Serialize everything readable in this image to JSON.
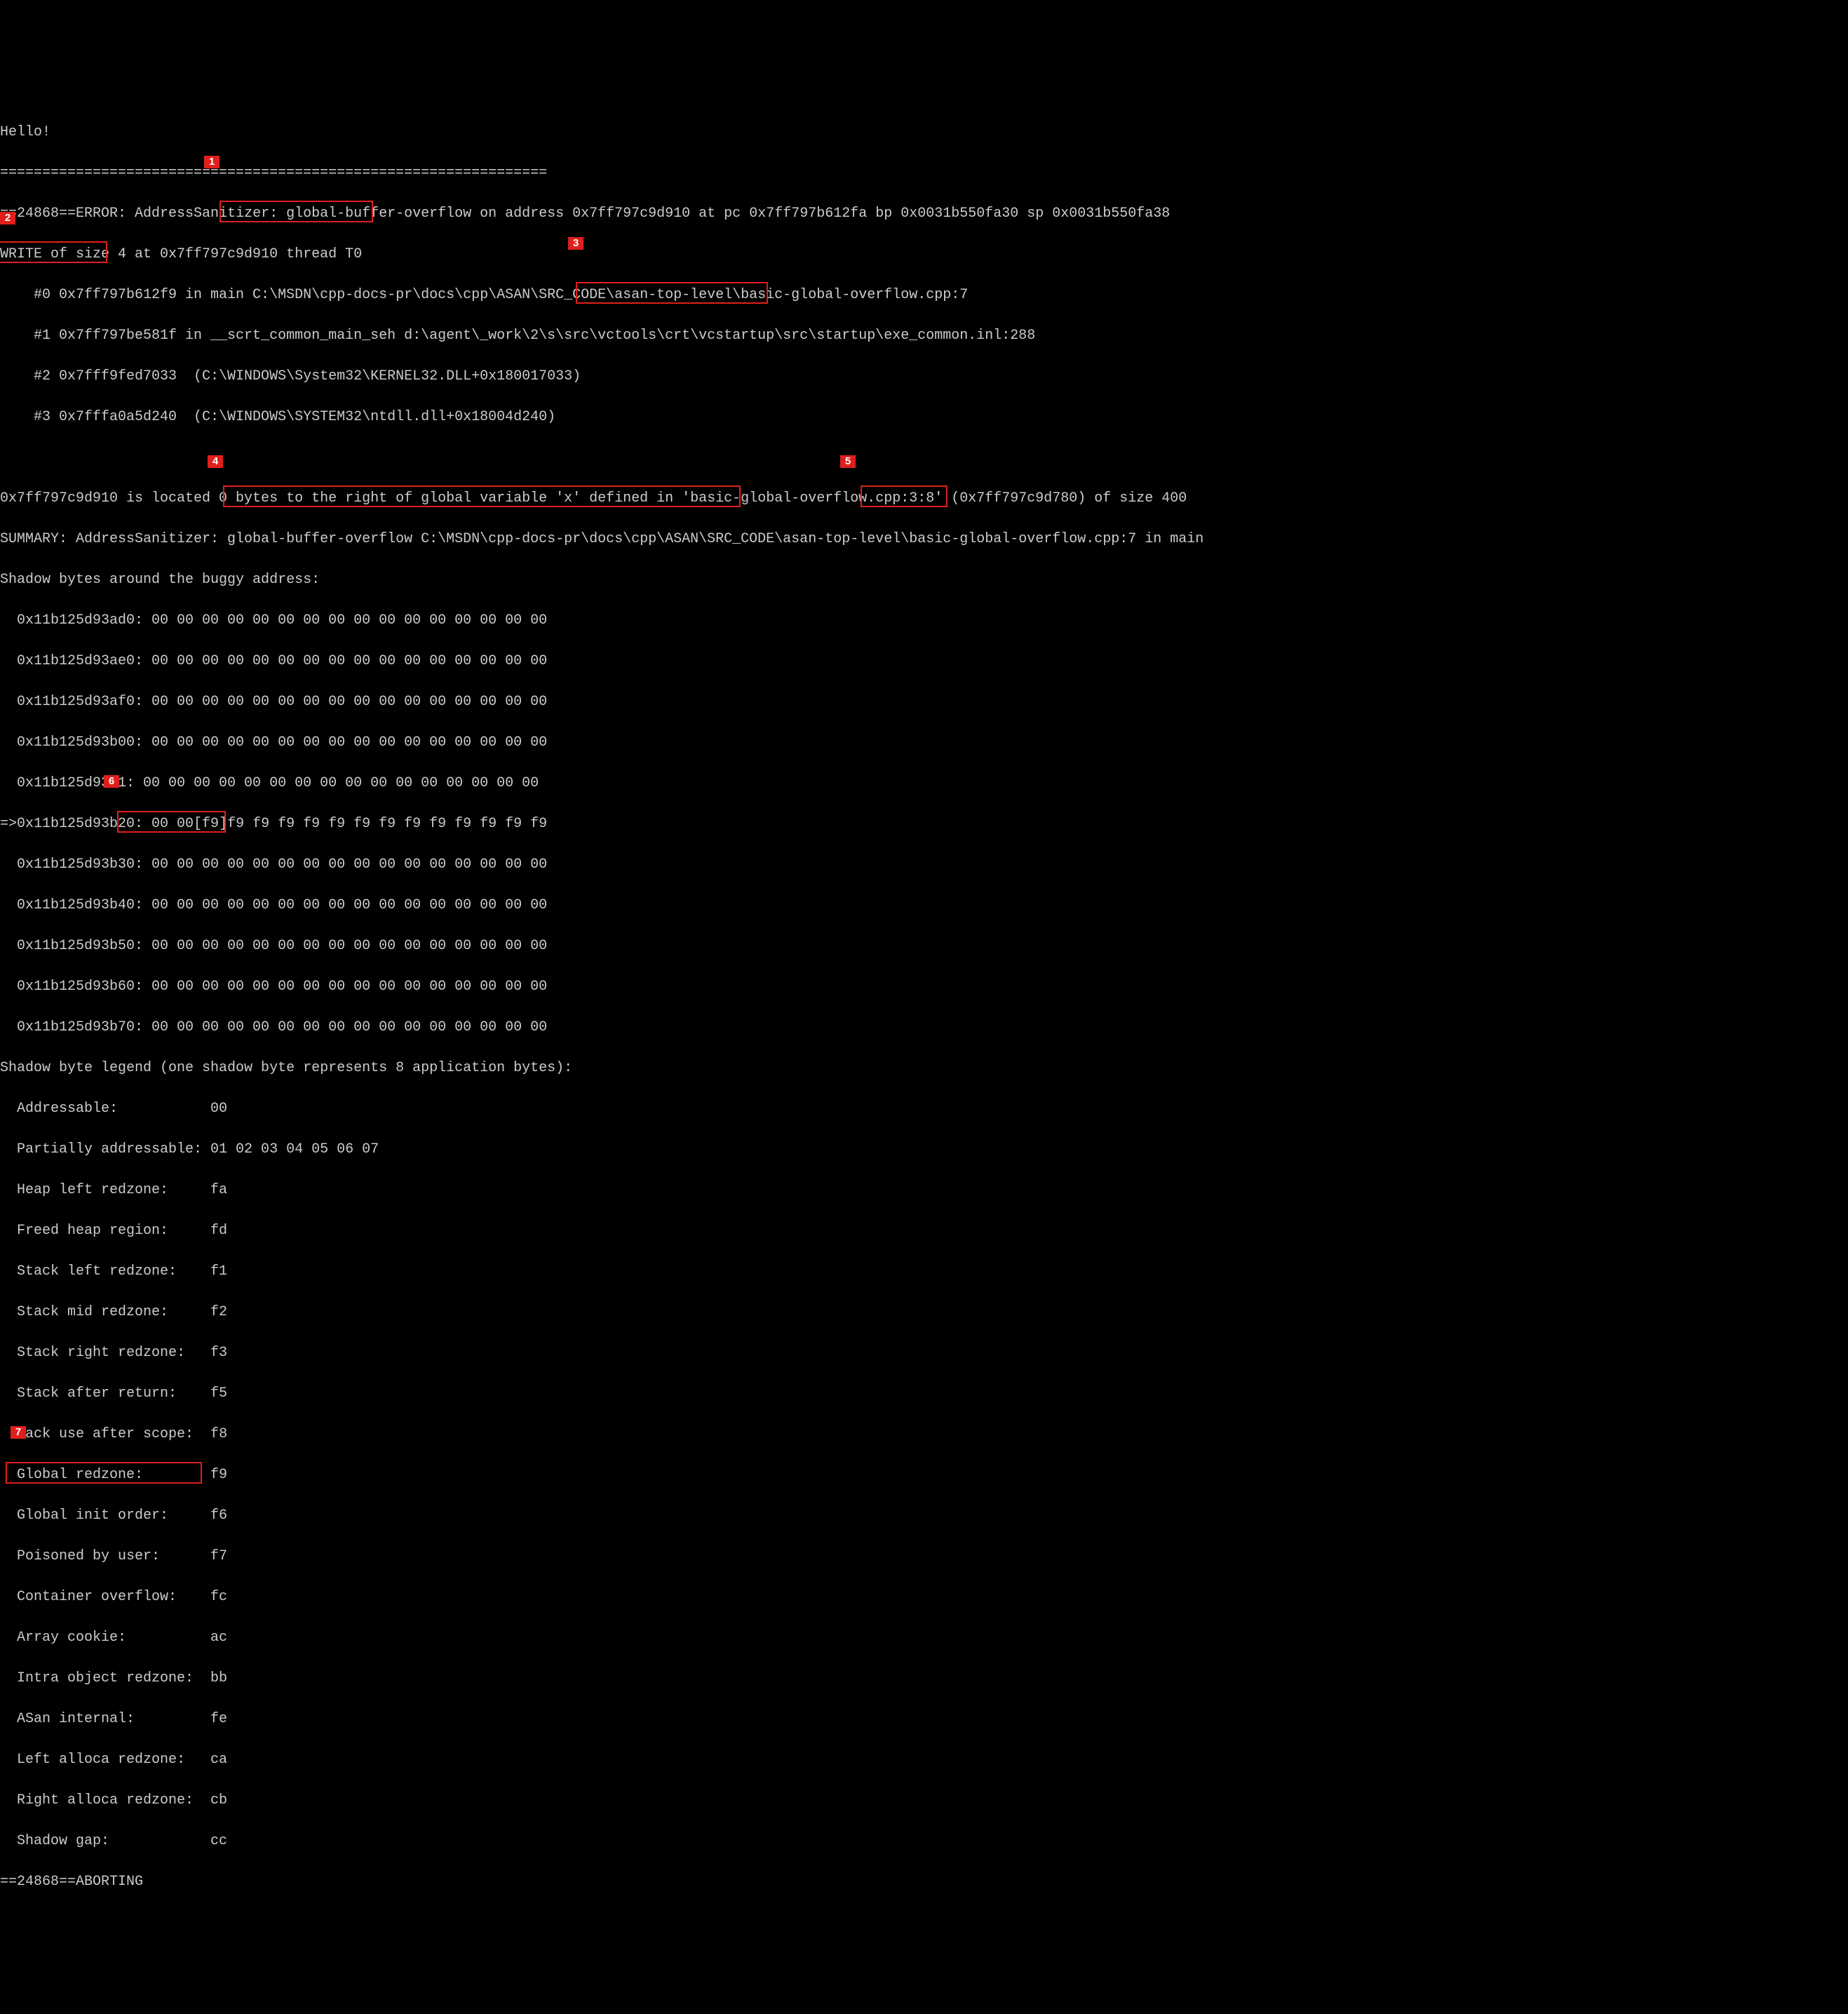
{
  "lines": {
    "l0": "Hello!",
    "l1": "=================================================================",
    "l2_a": "==",
    "l2_b": "24868==ERROR: AddressSanitizer: ",
    "l2_c": "global-buffer-overflow",
    "l2_d": " on address 0x7ff797c9d910 at pc 0x7ff797b612fa bp 0x0031b550fa30 sp 0x0031b550fa38",
    "l3_a": "WRITE of size 4",
    "l3_b": " at 0x7ff797c9d910 thread T0",
    "l4_a": "    #0 0x7ff797b612f9 in main C:\\MSDN\\cpp-docs-pr\\docs\\cpp\\ASAN\\SRC_CODE\\asan-top-level\\",
    "l4_b": "basic-global-overflow.cpp:7",
    "l5": "    #1 0x7ff797be581f in __scrt_common_main_seh d:\\agent\\_work\\2\\s\\src\\vctools\\crt\\vcstartup\\src\\startup\\exe_common.inl:288",
    "l6": "    #2 0x7fff9fed7033  (C:\\WINDOWS\\System32\\KERNEL32.DLL+0x180017033)",
    "l7": "    #3 0x7fffa0a5d240  (C:\\WINDOWS\\SYSTEM32\\ntdll.dll+0x18004d240)",
    "l8": "",
    "l9_a": "0x7ff797c9d910 is located 0 bytes ",
    "l9_b": "to the right of global variable 'x' defined in 'basic-global-overflow.cpp:3:8'",
    "l9_c": " (0x7ff797c9d780) ",
    "l9_d": "of size 400",
    "l10": "SUMMARY: AddressSanitizer: global-buffer-overflow C:\\MSDN\\cpp-docs-pr\\docs\\cpp\\ASAN\\SRC_CODE\\asan-top-level\\basic-global-overflow.cpp:7 in main",
    "l11": "Shadow bytes around the buggy address:",
    "l12": "  0x11b125d93ad0: 00 00 00 00 00 00 00 00 00 00 00 00 00 00 00 00",
    "l13": "  0x11b125d93ae0: 00 00 00 00 00 00 00 00 00 00 00 00 00 00 00 00",
    "l14": "  0x11b125d93af0: 00 00 00 00 00 00 00 00 00 00 00 00 00 00 00 00",
    "l15": "  0x11b125d93b00: 00 00 00 00 00 00 00 00 00 00 00 00 00 00 00 00",
    "l16_a": "  0x11b125d93b1",
    "l16_b": ": 00 00 00 00 00 00 00 00 00 00 00 00 00 00 00 00",
    "l17_a": "=>0x11b125d93b20: ",
    "l17_b": "00 00[f9]f9 f9 ",
    "l17_c": "f9 f9 f9 f9 f9 f9 f9 f9 f9 f9 f9",
    "l18": "  0x11b125d93b30: 00 00 00 00 00 00 00 00 00 00 00 00 00 00 00 00",
    "l19": "  0x11b125d93b40: 00 00 00 00 00 00 00 00 00 00 00 00 00 00 00 00",
    "l20": "  0x11b125d93b50: 00 00 00 00 00 00 00 00 00 00 00 00 00 00 00 00",
    "l21": "  0x11b125d93b60: 00 00 00 00 00 00 00 00 00 00 00 00 00 00 00 00",
    "l22": "  0x11b125d93b70: 00 00 00 00 00 00 00 00 00 00 00 00 00 00 00 00",
    "l23": "Shadow byte legend (one shadow byte represents 8 application bytes):",
    "l24": "  Addressable:           00",
    "l25": "  Partially addressable: 01 02 03 04 05 06 07",
    "l26": "  Heap left redzone:     fa",
    "l27": "  Freed heap region:     fd",
    "l28": "  Stack left redzone:    f1",
    "l29": "  Stack mid redzone:     f2",
    "l30": "  Stack right redzone:   f3",
    "l31": "  Stack after return:    f5",
    "l32_a": "  ",
    "l32_b": "tack use after scope:  f8",
    "l33": "  Global redzone:        f9",
    "l34": "  Global init order:     f6",
    "l35": "  Poisoned by user:      f7",
    "l36": "  Container overflow:    fc",
    "l37": "  Array cookie:          ac",
    "l38": "  Intra object redzone:  bb",
    "l39": "  ASan internal:         fe",
    "l40": "  Left alloca redzone:   ca",
    "l41": "  Right alloca redzone:  cb",
    "l42": "  Shadow gap:            cc",
    "l43": "==24868==ABORTING"
  },
  "callouts": {
    "c1": "1",
    "c2": "2",
    "c3": "3",
    "c4": "4",
    "c5": "5",
    "c6": "6",
    "c7": "7"
  }
}
